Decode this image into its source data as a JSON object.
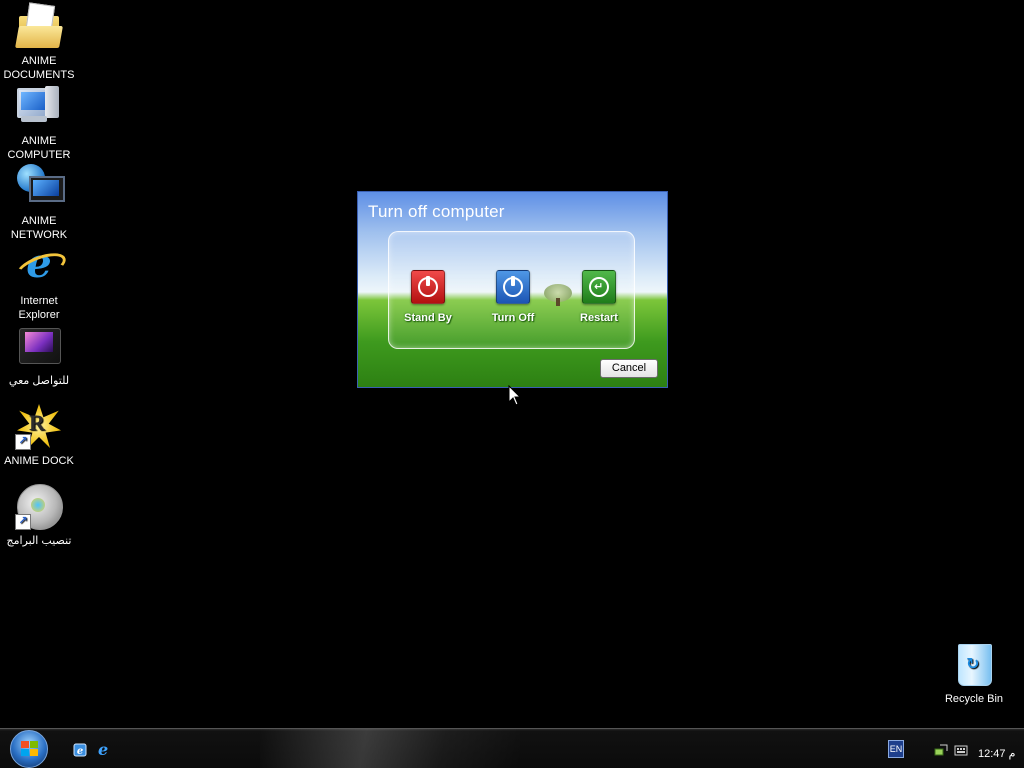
{
  "desktop_icons": [
    {
      "label": "ANIME\nDOCUMENTS",
      "icon": "folder-icon"
    },
    {
      "label": "ANIME\nCOMPUTER",
      "icon": "computer-icon"
    },
    {
      "label": "ANIME\nNETWORK",
      "icon": "network-icon"
    },
    {
      "label": "Internet\nExplorer",
      "icon": "internet-explorer-icon"
    },
    {
      "label": "للتواصل معي",
      "icon": "folder-icon"
    },
    {
      "label": "ANIME DOCK",
      "icon": "dock-icon"
    },
    {
      "label": "تنصيب البرامج",
      "icon": "installer-icon"
    }
  ],
  "recycle_bin": {
    "label": "Recycle Bin",
    "icon": "recycle-bin-icon"
  },
  "dialog": {
    "title": "Turn off computer",
    "options": [
      {
        "label": "Stand By",
        "icon": "power-icon",
        "color": "#d42a2a"
      },
      {
        "label": "Turn Off",
        "icon": "power-icon",
        "color": "#2a6fd0"
      },
      {
        "label": "Restart",
        "icon": "restart-icon",
        "color": "#2f9a2a"
      }
    ],
    "cancel_label": "Cancel"
  },
  "taskbar": {
    "start_icon": "windows-start-icon",
    "quicklaunch": [
      "explorer-icon",
      "internet-explorer-icon"
    ],
    "language": "EN",
    "tray_icons": [
      "network-icon",
      "keyboard-icon"
    ],
    "clock": "12:47 م"
  }
}
